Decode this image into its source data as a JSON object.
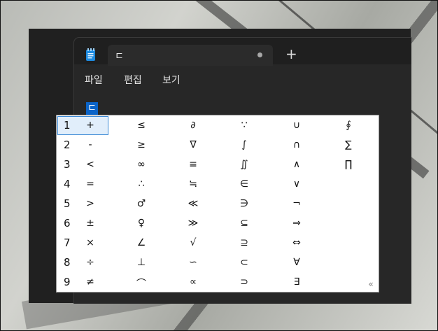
{
  "tab": {
    "title": "ㄷ",
    "unsaved_icon": "dot-icon",
    "new_tab_label": "+"
  },
  "menu": {
    "items": [
      "파일",
      "편집",
      "보기"
    ]
  },
  "editor": {
    "typed_text": "ㄷ"
  },
  "candidates": {
    "row_numbers": [
      "1",
      "2",
      "3",
      "4",
      "5",
      "6",
      "7",
      "8",
      "9"
    ],
    "rows": [
      [
        "+",
        "≤",
        "∂",
        "∵",
        "∪",
        "∮"
      ],
      [
        "-",
        "≥",
        "∇",
        "∫",
        "∩",
        "∑"
      ],
      [
        "<",
        "∞",
        "≡",
        "∬",
        "∧",
        "∏"
      ],
      [
        "=",
        "∴",
        "≒",
        "∈",
        "∨",
        ""
      ],
      [
        ">",
        "♂",
        "≪",
        "∋",
        "¬",
        ""
      ],
      [
        "±",
        "♀",
        "≫",
        "⊆",
        "⇒",
        ""
      ],
      [
        "×",
        "∠",
        "√",
        "⊇",
        "⇔",
        ""
      ],
      [
        "÷",
        "⊥",
        "∽",
        "⊂",
        "∀",
        ""
      ],
      [
        "≠",
        "⌒",
        "∝",
        "⊃",
        "∃",
        ""
      ]
    ],
    "expand_label": "«"
  },
  "colors": {
    "selection": "#0b64c8",
    "selected_row": "#e1eefb",
    "selected_border": "#3c8ad6"
  }
}
